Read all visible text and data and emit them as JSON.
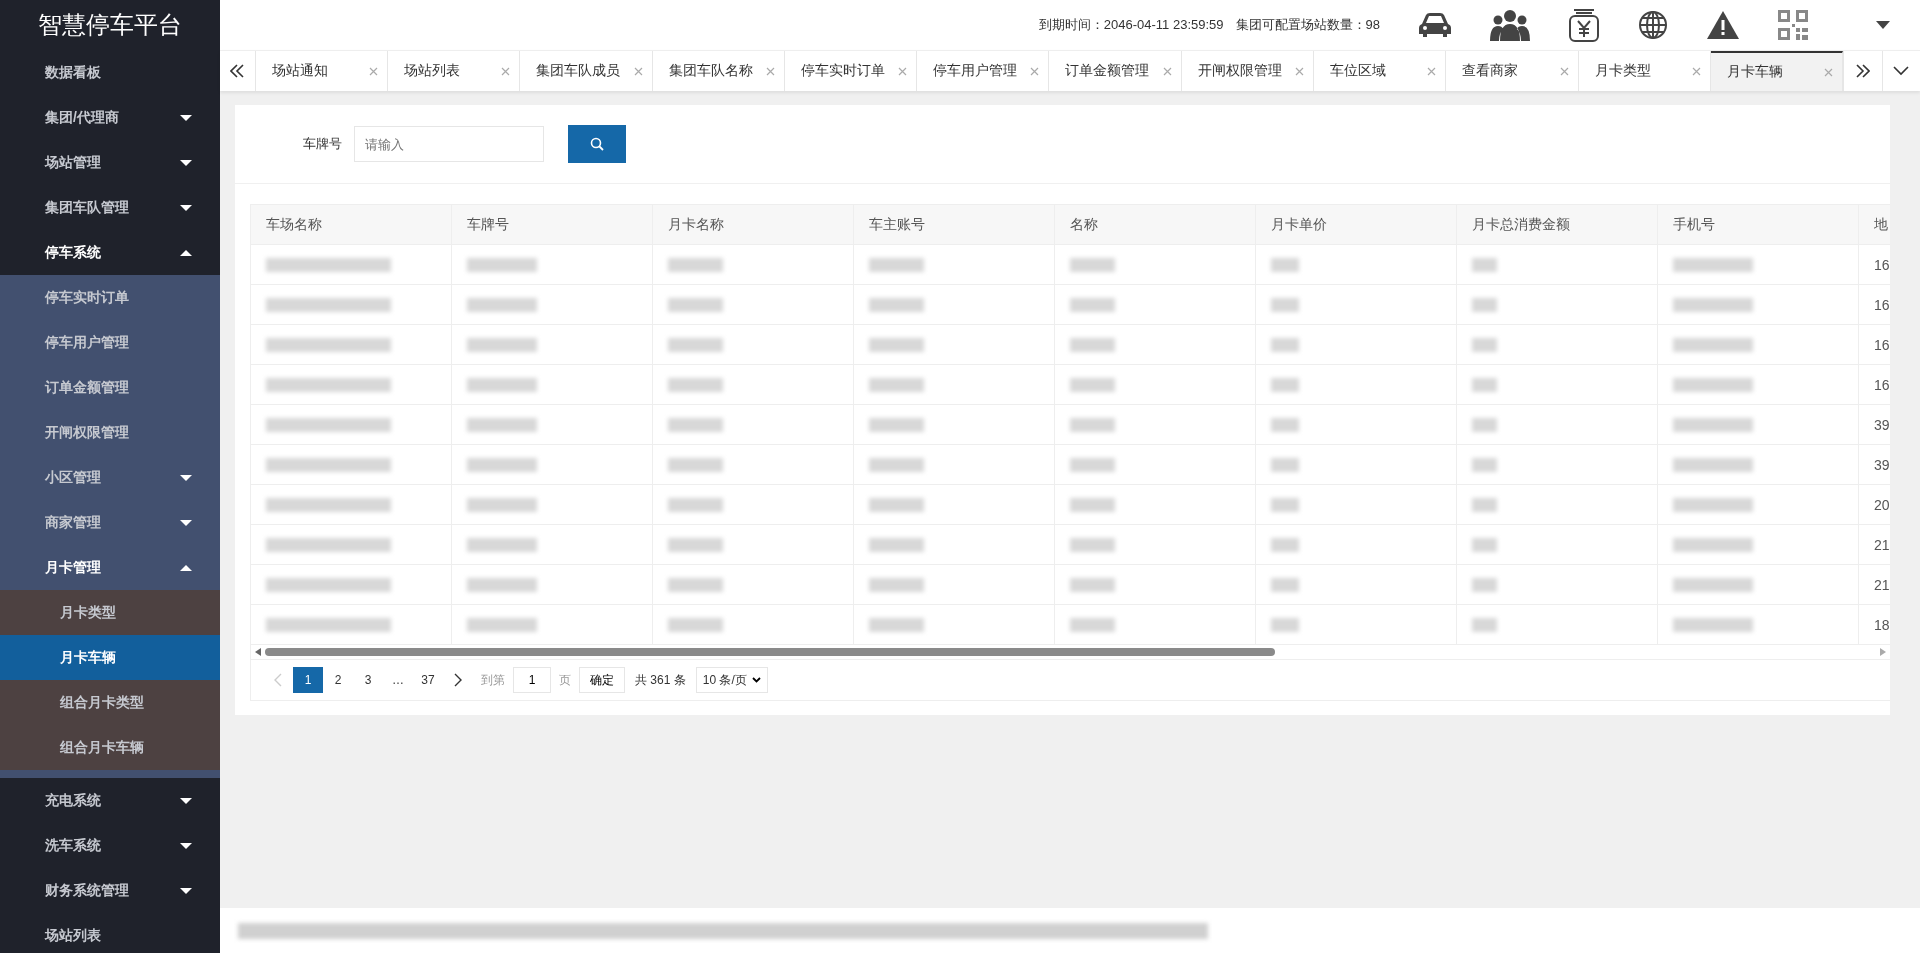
{
  "sidebar": {
    "title": "智慧停车平台",
    "items": [
      {
        "label": "数据看板",
        "selected": false
      },
      {
        "label": "集团/代理商",
        "selected": false,
        "expanded": false
      },
      {
        "label": "场站管理",
        "selected": false,
        "expanded": false
      },
      {
        "label": "集团车队管理",
        "selected": false,
        "expanded": false
      },
      {
        "label": "停车系统",
        "selected": false,
        "expanded": true,
        "children": [
          {
            "label": "停车实时订单",
            "selected": false
          },
          {
            "label": "停车用户管理",
            "selected": false
          },
          {
            "label": "订单金额管理",
            "selected": false
          },
          {
            "label": "开闸权限管理",
            "selected": false
          },
          {
            "label": "小区管理",
            "selected": false,
            "expanded": false
          },
          {
            "label": "商家管理",
            "selected": false,
            "expanded": false
          },
          {
            "label": "月卡管理",
            "selected": false,
            "expanded": true,
            "children": [
              {
                "label": "月卡类型",
                "selected": false
              },
              {
                "label": "月卡车辆",
                "selected": true
              },
              {
                "label": "组合月卡类型",
                "selected": false
              },
              {
                "label": "组合月卡车辆",
                "selected": false
              }
            ]
          }
        ]
      },
      {
        "label": "充电系统",
        "selected": false,
        "expanded": false
      },
      {
        "label": "洗车系统",
        "selected": false,
        "expanded": false
      },
      {
        "label": "财务系统管理",
        "selected": false,
        "expanded": false
      },
      {
        "label": "场站列表",
        "selected": false
      }
    ]
  },
  "header": {
    "expiry": "到期时间：2046-04-11 23:59:59",
    "station_quota": "集团可配置场站数量：98"
  },
  "tabs": [
    {
      "label": "场站通知",
      "selected": false
    },
    {
      "label": "场站列表",
      "selected": false
    },
    {
      "label": "集团车队成员",
      "selected": false
    },
    {
      "label": "集团车队名称",
      "selected": false
    },
    {
      "label": "停车实时订单",
      "selected": false
    },
    {
      "label": "停车用户管理",
      "selected": false
    },
    {
      "label": "订单金额管理",
      "selected": false
    },
    {
      "label": "开闸权限管理",
      "selected": false
    },
    {
      "label": "车位区域",
      "selected": false
    },
    {
      "label": "查看商家",
      "selected": false
    },
    {
      "label": "月卡类型",
      "selected": false
    },
    {
      "label": "月卡车辆",
      "selected": true
    }
  ],
  "search": {
    "label": "车牌号",
    "placeholder": "请输入"
  },
  "table": {
    "columns": [
      "车场名称",
      "车牌号",
      "月卡名称",
      "车主账号",
      "名称",
      "月卡单价",
      "月卡总消费金额",
      "手机号",
      "地"
    ],
    "rows": [
      {
        "column_9": "16"
      },
      {
        "column_9": "16"
      },
      {
        "column_9": "16"
      },
      {
        "column_9": "16"
      },
      {
        "column_9": "39"
      },
      {
        "column_9": "39"
      },
      {
        "column_9": "20"
      },
      {
        "column_9": "21"
      },
      {
        "column_9": "21"
      },
      {
        "column_9": "18"
      }
    ]
  },
  "pagination": {
    "pages": [
      {
        "label": "1",
        "selected": true
      },
      {
        "label": "2",
        "selected": false
      },
      {
        "label": "3",
        "selected": false
      },
      {
        "label": "…",
        "selected": false
      },
      {
        "label": "37",
        "selected": false
      }
    ],
    "prev_disabled": true,
    "goto_label": "到第",
    "goto_value": "1",
    "page_unit": "页",
    "confirm": "确定",
    "total": "共 361 条",
    "page_size": "10 条/页"
  }
}
